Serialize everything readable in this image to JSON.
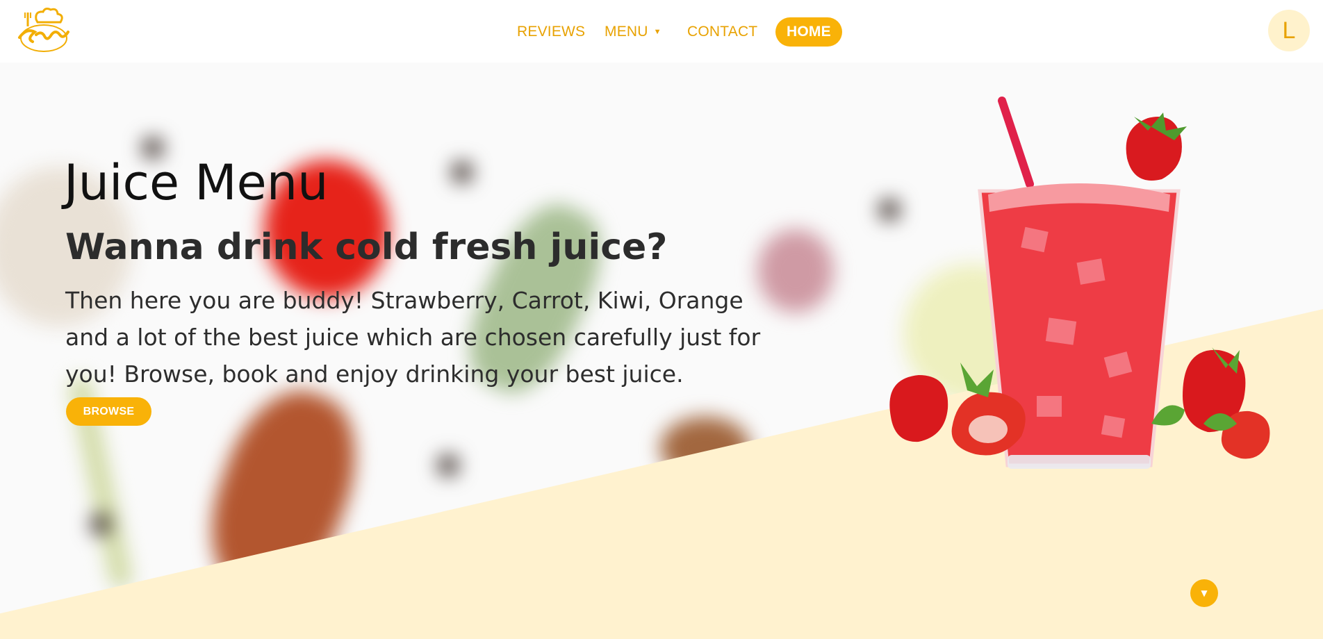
{
  "nav": {
    "items": [
      {
        "label": "REVIEWS"
      },
      {
        "label": "MENU"
      },
      {
        "label": "CONTACT"
      },
      {
        "label": "HOME"
      }
    ]
  },
  "user": {
    "initial": "L"
  },
  "hero": {
    "title": "Juice Menu",
    "subtitle": "Wanna drink cold fresh juice?",
    "body": "Then here you are buddy! Strawberry, Carrot, Kiwi, Orange and a lot of the best juice which are chosen carefully just for you! Browse, book and enjoy drinking your best juice.",
    "browse_label": "BROWSE"
  },
  "icons": {
    "logo": "catering-logo-icon",
    "menu_caret": "caret-down-icon",
    "scroll": "chevron-down-icon",
    "illustration": "strawberry-juice-glass-icon"
  },
  "colors": {
    "accent": "#f9b208",
    "accent_text": "#e8a202",
    "cream": "#fff2cf"
  }
}
